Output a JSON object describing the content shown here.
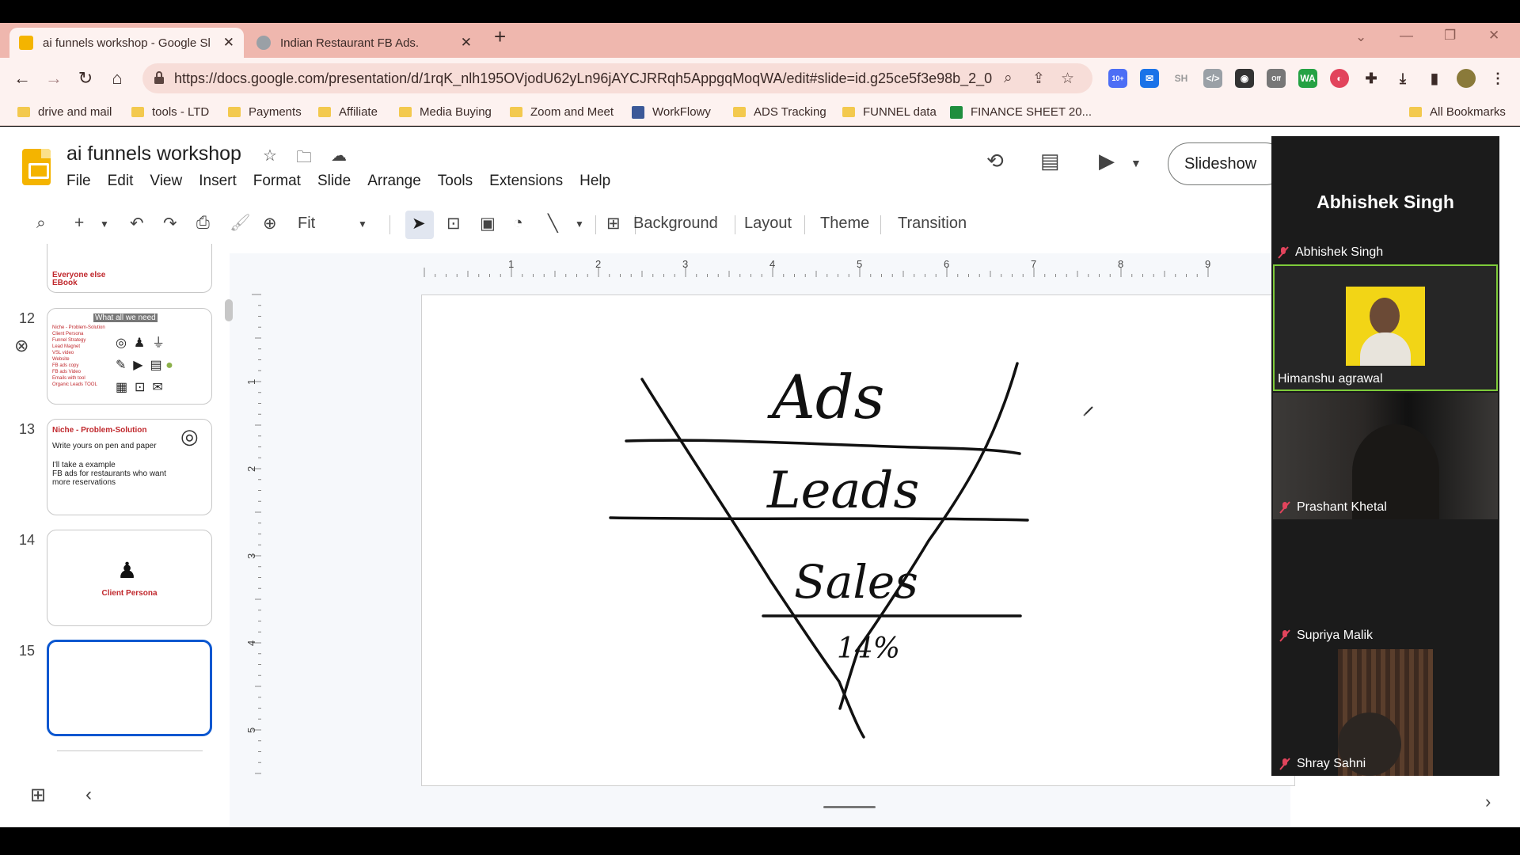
{
  "browser": {
    "tabs": [
      {
        "title": "ai funnels workshop - Google Sl",
        "active": true
      },
      {
        "title": "Indian Restaurant FB Ads.",
        "active": false
      }
    ],
    "url": "https://docs.google.com/presentation/d/1rqK_nlh195OVjodU62yLn96jAYCJRRqh5AppgqMoqWA/edit#slide=id.g25ce5f3e98b_2_0",
    "ext_badge": "10+",
    "ext_labels": {
      "sh": "SH",
      "wa": "WA",
      "off": "Off"
    },
    "bookmarks": [
      {
        "label": "drive and mail",
        "kind": "folder"
      },
      {
        "label": "tools - LTD",
        "kind": "folder"
      },
      {
        "label": "Payments",
        "kind": "folder"
      },
      {
        "label": "Affiliate",
        "kind": "folder"
      },
      {
        "label": "Media Buying",
        "kind": "folder"
      },
      {
        "label": "Zoom and Meet",
        "kind": "folder"
      },
      {
        "label": "WorkFlowy",
        "kind": "site"
      },
      {
        "label": "ADS Tracking",
        "kind": "folder"
      },
      {
        "label": "FUNNEL data",
        "kind": "folder"
      },
      {
        "label": "FINANCE SHEET 20...",
        "kind": "sheet"
      }
    ],
    "all_bookmarks": "All Bookmarks"
  },
  "slides": {
    "doc_title": "ai funnels workshop",
    "menu": [
      "File",
      "Edit",
      "View",
      "Insert",
      "Format",
      "Slide",
      "Arrange",
      "Tools",
      "Extensions",
      "Help"
    ],
    "slideshow_label": "Slideshow",
    "zoom": "Fit",
    "toolbar_text": {
      "background": "Background",
      "layout": "Layout",
      "theme": "Theme",
      "transition": "Transition"
    },
    "ruler_h": [
      "1",
      "2",
      "3",
      "4",
      "5",
      "6",
      "7",
      "8",
      "9"
    ],
    "ruler_v": [
      "1",
      "2",
      "3",
      "4",
      "5"
    ],
    "filmstrip": {
      "partial_text": [
        "Everyone else",
        "EBook"
      ],
      "slides": [
        {
          "num": "12",
          "title": "What all we need",
          "items": [
            "Niche - Problem-Solution",
            "Client Persona",
            "Funnel Strategy",
            "Lead Magnet",
            "VSL video",
            "Website",
            "FB ads copy",
            "FB ads Video",
            "Emails with tool",
            "Organic Leads TOOL"
          ]
        },
        {
          "num": "13",
          "title": "Niche - Problem-Solution",
          "lines": [
            "Write yours on pen and paper",
            "I'll take a example",
            "FB ads for restaurants who want",
            "more reservations"
          ]
        },
        {
          "num": "14",
          "title": "Client Persona"
        },
        {
          "num": "15",
          "title": ""
        }
      ]
    },
    "drawing_words": [
      "Ads",
      "Leads",
      "Sales",
      "14%"
    ]
  },
  "meeting": {
    "speaker": "Abhishek Singh",
    "participants": [
      {
        "name": "Abhishek Singh",
        "muted": true
      },
      {
        "name": "Himanshu agrawal",
        "muted": false
      },
      {
        "name": "Prashant Khetal",
        "muted": true
      },
      {
        "name": "Supriya Malik",
        "muted": true
      },
      {
        "name": "Shray Sahni",
        "muted": true
      }
    ]
  }
}
